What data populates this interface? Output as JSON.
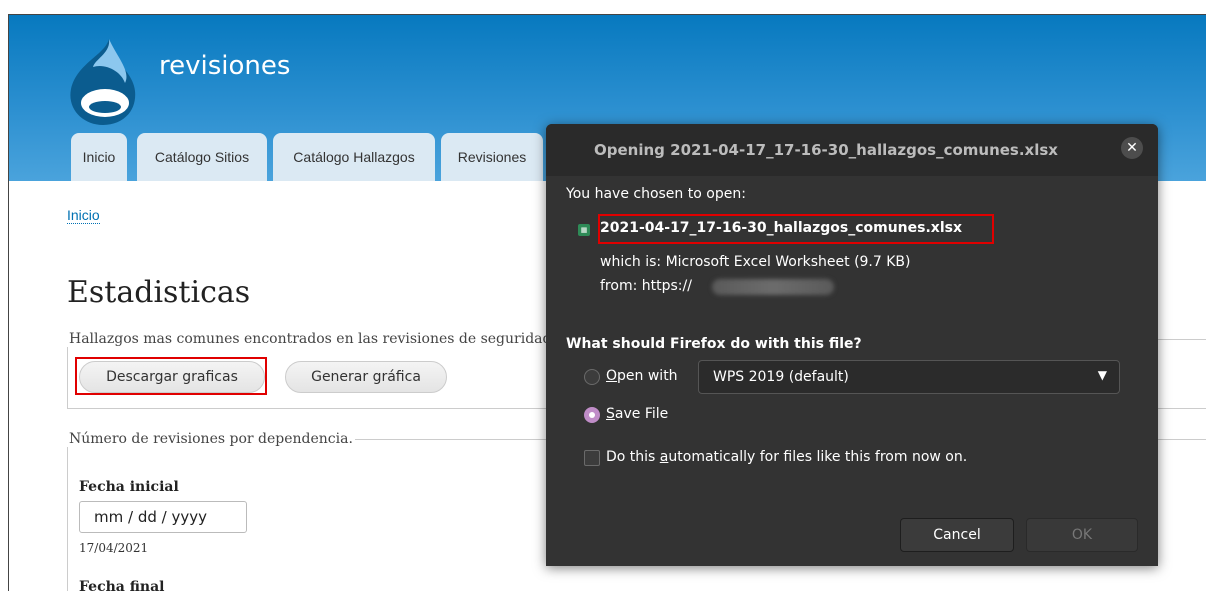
{
  "site": {
    "name": "revisiones",
    "tabs": [
      "Inicio",
      "Catálogo Sitios",
      "Catálogo Hallazgos",
      "Revisiones"
    ]
  },
  "breadcrumb": "Inicio",
  "page_title": "Estadisticas",
  "section1": {
    "legend": "Hallazgos mas comunes encontrados en las revisiones de seguridad.",
    "download_button": "Descargar graficas",
    "generate_button": "Generar gráfica"
  },
  "section2": {
    "legend": "Número de revisiones por dependencia.",
    "start_label": "Fecha inicial",
    "start_placeholder": "mm / dd / yyyy",
    "start_value": "17/04/2021",
    "end_label": "Fecha final"
  },
  "dialog": {
    "title": "Opening 2021-04-17_17-16-30_hallazgos_comunes.xlsx",
    "close_icon": "close-icon",
    "intro": "You have chosen to open:",
    "file_icon": "spreadsheet-icon",
    "filename": "2021-04-17_17-16-30_hallazgos_comunes.xlsx",
    "which_is": "which is: Microsoft Excel Worksheet (9.7 KB)",
    "from": "from: https://",
    "question": "What should Firefox do with this file?",
    "open_with_prefix": "",
    "open_with_underlined": "O",
    "open_with_rest": "pen with",
    "open_with_app": "WPS 2019 (default)",
    "save_underlined": "S",
    "save_rest": "ave File",
    "auto_prefix": "Do this ",
    "auto_underlined": "a",
    "auto_rest": "utomatically for files like this from now on.",
    "cancel": "Cancel",
    "ok": "OK",
    "selected_action": "Save File",
    "auto_checked": false
  },
  "colors": {
    "header_blue": "#0779bf",
    "highlight_red": "#e00000",
    "dialog_bg": "#333333",
    "radio_accent": "#c08dc8"
  }
}
